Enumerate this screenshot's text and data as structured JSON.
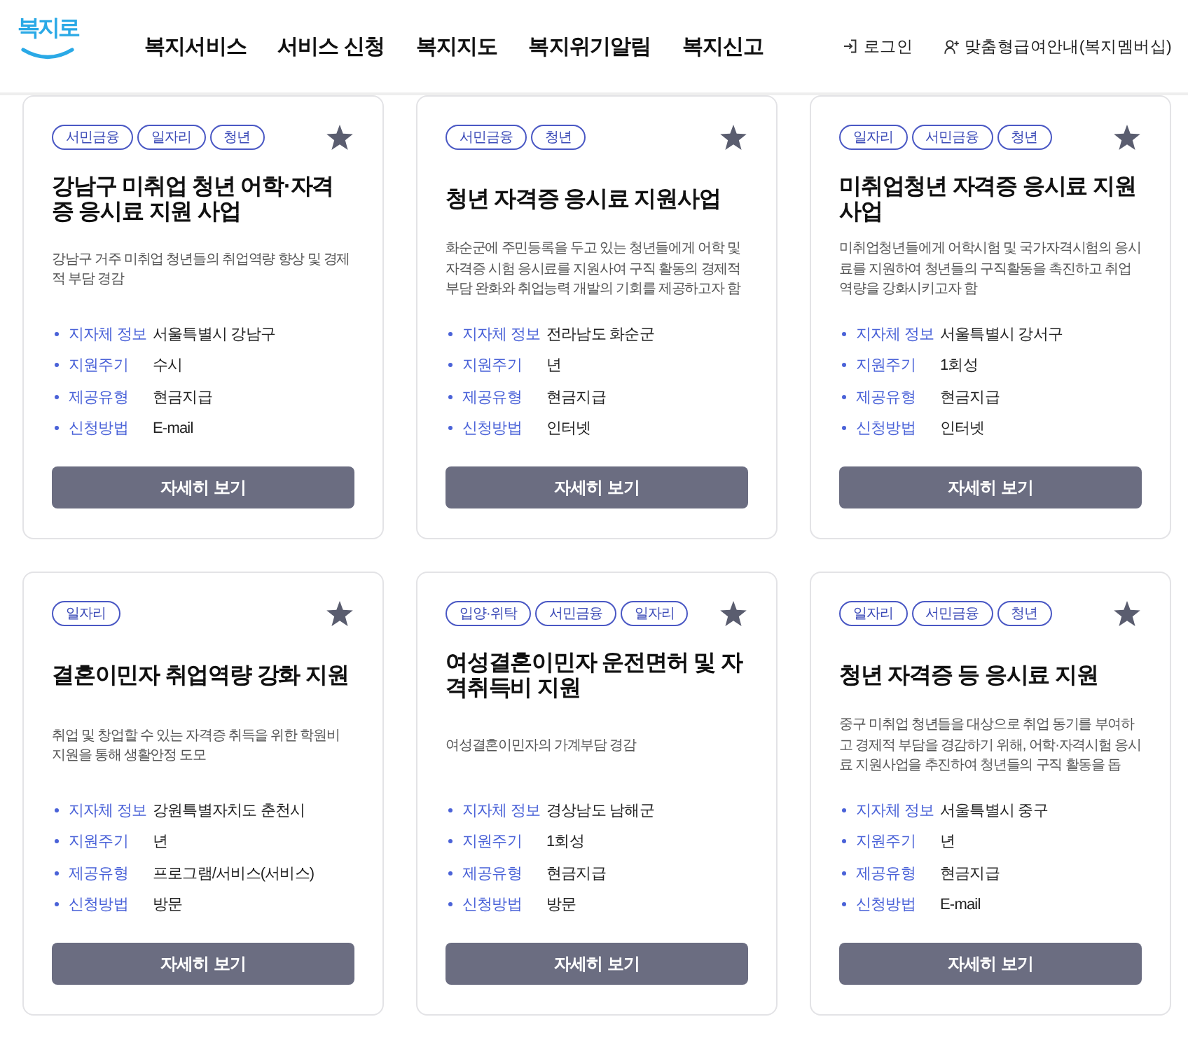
{
  "header": {
    "logo": "복지로",
    "nav": [
      "복지서비스",
      "서비스 신청",
      "복지지도",
      "복지위기알림",
      "복지신고"
    ],
    "login": "로그인",
    "membership": "맞춤형급여안내(복지멤버십)"
  },
  "cards": [
    {
      "tags": [
        "서민금융",
        "일자리",
        "청년"
      ],
      "title": "강남구 미취업 청년 어학·자격증 응시료 지원 사업",
      "description": "강남구 거주 미취업 청년들의 취업역량 향상 및 경제적 부담 경감",
      "info": [
        {
          "label": "지자체 정보",
          "value": "서울특별시 강남구"
        },
        {
          "label": "지원주기",
          "value": "수시"
        },
        {
          "label": "제공유형",
          "value": "현금지급"
        },
        {
          "label": "신청방법",
          "value": "E-mail"
        }
      ],
      "button": "자세히 보기"
    },
    {
      "tags": [
        "서민금융",
        "청년"
      ],
      "title": "청년 자격증 응시료 지원사업",
      "description": "화순군에 주민등록을 두고 있는 청년들에게 어학 및 자격증 시험 응시료를 지원사여 구직 활동의 경제적 부담 완화와 취업능력 개발의 기회를 제공하고자 함",
      "info": [
        {
          "label": "지자체 정보",
          "value": "전라남도 화순군"
        },
        {
          "label": "지원주기",
          "value": "년"
        },
        {
          "label": "제공유형",
          "value": "현금지급"
        },
        {
          "label": "신청방법",
          "value": "인터넷"
        }
      ],
      "button": "자세히 보기"
    },
    {
      "tags": [
        "일자리",
        "서민금융",
        "청년"
      ],
      "title": "미취업청년 자격증 응시료 지원 사업",
      "description": "미취업청년들에게 어학시험 및 국가자격시험의 응시료를 지원하여 청년들의 구직활동을 촉진하고 취업역량을 강화시키고자 함",
      "info": [
        {
          "label": "지자체 정보",
          "value": "서울특별시 강서구"
        },
        {
          "label": "지원주기",
          "value": "1회성"
        },
        {
          "label": "제공유형",
          "value": "현금지급"
        },
        {
          "label": "신청방법",
          "value": "인터넷"
        }
      ],
      "button": "자세히 보기"
    },
    {
      "tags": [
        "일자리"
      ],
      "title": "결혼이민자 취업역량 강화 지원",
      "description": "취업 및 창업할 수 있는 자격증 취득을 위한 학원비 지원을 통해 생활안정 도모",
      "info": [
        {
          "label": "지자체 정보",
          "value": "강원특별자치도 춘천시"
        },
        {
          "label": "지원주기",
          "value": "년"
        },
        {
          "label": "제공유형",
          "value": "프로그램/서비스(서비스)"
        },
        {
          "label": "신청방법",
          "value": "방문"
        }
      ],
      "button": "자세히 보기"
    },
    {
      "tags": [
        "입양·위탁",
        "서민금융",
        "일자리"
      ],
      "title": "여성결혼이민자 운전면허 및 자격취득비 지원",
      "description": "여성결혼이민자의 가계부담 경감",
      "info": [
        {
          "label": "지자체 정보",
          "value": "경상남도 남해군"
        },
        {
          "label": "지원주기",
          "value": "1회성"
        },
        {
          "label": "제공유형",
          "value": "현금지급"
        },
        {
          "label": "신청방법",
          "value": "방문"
        }
      ],
      "button": "자세히 보기"
    },
    {
      "tags": [
        "일자리",
        "서민금융",
        "청년"
      ],
      "title": "청년 자격증 등 응시료 지원",
      "description": "중구 미취업 청년들을 대상으로 취업 동기를 부여하고 경제적 부담을 경감하기 위해, 어학·자격시험 응시료 지원사업을 추진하여 청년들의 구직 활동을 돕",
      "info": [
        {
          "label": "지자체 정보",
          "value": "서울특별시 중구"
        },
        {
          "label": "지원주기",
          "value": "년"
        },
        {
          "label": "제공유형",
          "value": "현금지급"
        },
        {
          "label": "신청방법",
          "value": "E-mail"
        }
      ],
      "button": "자세히 보기"
    }
  ]
}
